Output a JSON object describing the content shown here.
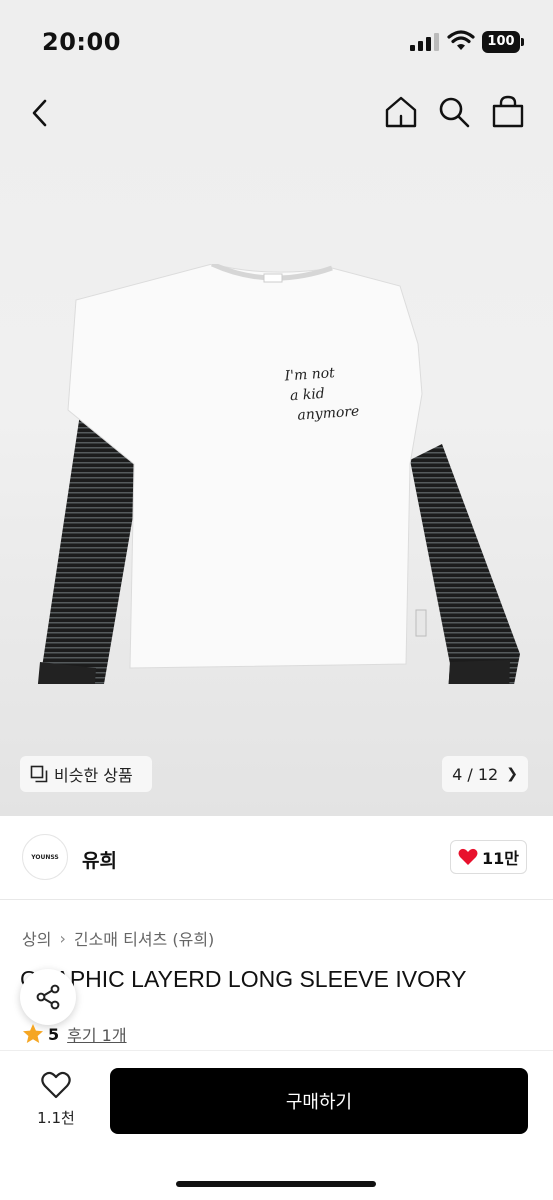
{
  "status_bar": {
    "time": "20:00",
    "battery": "100",
    "icons": [
      "signal-icon",
      "wifi-icon",
      "battery-icon"
    ]
  },
  "nav": {
    "icons": [
      "back-icon",
      "home-icon",
      "search-icon",
      "shopping-bag-icon"
    ]
  },
  "hero": {
    "print_text": [
      "I'm not",
      "a kid",
      "anymore"
    ],
    "tag_text": "YOUNSS",
    "similar_label": "비슷한 상품",
    "page_indicator": "4 / 12"
  },
  "brand": {
    "logo_text": "YOUNSS",
    "name": "유희",
    "likes": "11만"
  },
  "product": {
    "breadcrumb": [
      "상의",
      "긴소매 티셔츠 (유희)"
    ],
    "title": "GRAPHIC LAYERD LONG SLEEVE IVORY",
    "rating": "5",
    "reviews": "후기 1개"
  },
  "bottom_bar": {
    "wish_count": "1.1천",
    "buy_label": "구매하기"
  },
  "colors": {
    "heart": "#e8112d",
    "star": "#f5a623",
    "buy_button": "#000000",
    "shirt": "#fafafa",
    "sleeve": "#1c1c1c"
  }
}
